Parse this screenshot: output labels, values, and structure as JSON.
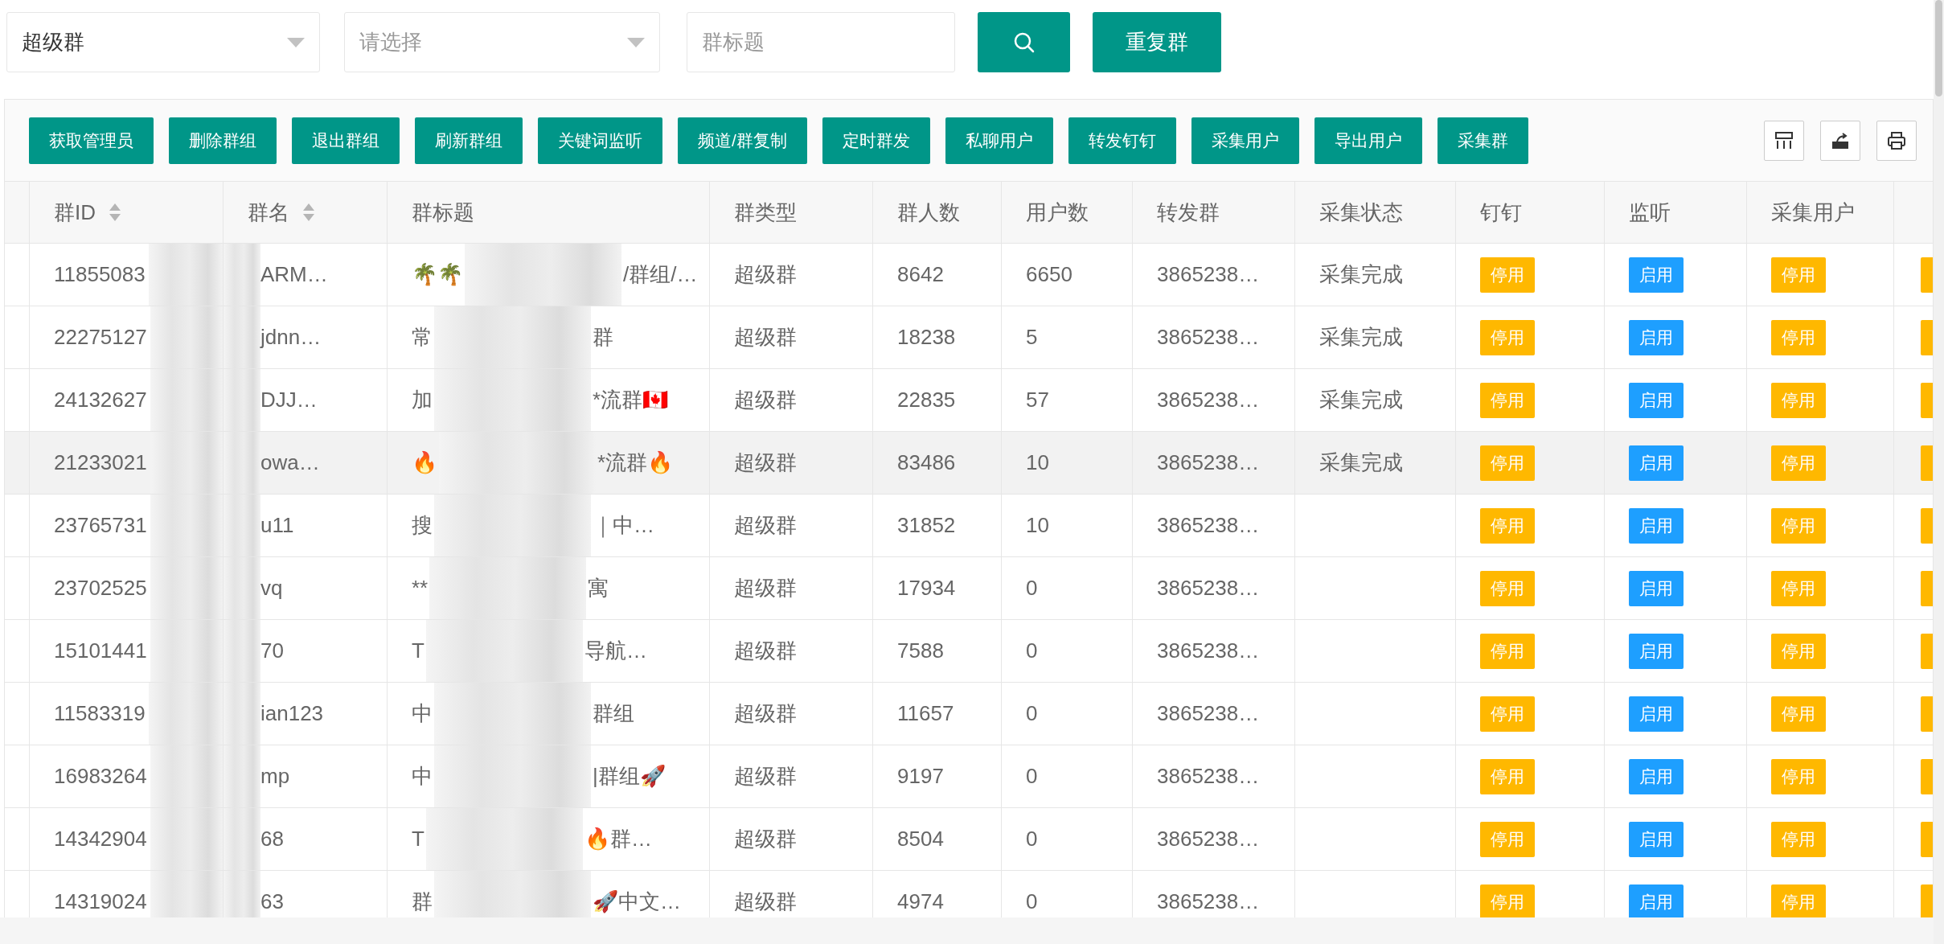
{
  "filters": {
    "group_type_select": {
      "value": "超级群"
    },
    "second_select": {
      "placeholder": "请选择"
    },
    "title_field": {
      "placeholder": "群标题"
    },
    "duplicate_button": "重复群"
  },
  "toolbar": {
    "buttons": [
      "获取管理员",
      "删除群组",
      "退出群组",
      "刷新群组",
      "关键词监听",
      "频道/群复制",
      "定时群发",
      "私聊用户",
      "转发钉钉",
      "采集用户",
      "导出用户",
      "采集群"
    ]
  },
  "table": {
    "columns": [
      {
        "label": "群ID",
        "sortable": true
      },
      {
        "label": "群名",
        "sortable": true
      },
      {
        "label": "群标题",
        "sortable": false
      },
      {
        "label": "群类型",
        "sortable": false
      },
      {
        "label": "群人数",
        "sortable": false
      },
      {
        "label": "用户数",
        "sortable": false
      },
      {
        "label": "转发群",
        "sortable": false
      },
      {
        "label": "采集状态",
        "sortable": false
      },
      {
        "label": "钉钉",
        "sortable": false
      },
      {
        "label": "监听",
        "sortable": false
      },
      {
        "label": "采集用户",
        "sortable": false
      }
    ],
    "rows": [
      {
        "id": "11855083",
        "name": "ARM…",
        "title_prefix": "🌴🌴",
        "title_suffix": "/群组/…",
        "type": "超级群",
        "members": "8642",
        "users": "6650",
        "forward": "3865238…",
        "status": "采集完成",
        "dingtalk": {
          "label": "停用",
          "kind": "warning"
        },
        "monitor": {
          "label": "启用",
          "kind": "normal"
        },
        "collect": {
          "label": "停用",
          "kind": "warning"
        },
        "column_13": {
          "kind": "warning"
        },
        "highlighted": false
      },
      {
        "id": "22275127",
        "name": "jdnn…",
        "title_prefix": "常",
        "title_suffix": "群",
        "type": "超级群",
        "members": "18238",
        "users": "5",
        "forward": "3865238…",
        "status": "采集完成",
        "dingtalk": {
          "label": "停用",
          "kind": "warning"
        },
        "monitor": {
          "label": "启用",
          "kind": "normal"
        },
        "collect": {
          "label": "停用",
          "kind": "warning"
        },
        "column_13": {
          "kind": "warning"
        },
        "highlighted": false
      },
      {
        "id": "24132627",
        "name": "DJJ…",
        "title_prefix": "加",
        "title_suffix": "*流群🇨🇦",
        "type": "超级群",
        "members": "22835",
        "users": "57",
        "forward": "3865238…",
        "status": "采集完成",
        "dingtalk": {
          "label": "停用",
          "kind": "warning"
        },
        "monitor": {
          "label": "启用",
          "kind": "normal"
        },
        "collect": {
          "label": "停用",
          "kind": "warning"
        },
        "column_13": {
          "kind": "warning"
        },
        "highlighted": false
      },
      {
        "id": "21233021",
        "name": "owa…",
        "title_prefix": "🔥",
        "title_suffix": "*流群🔥",
        "type": "超级群",
        "members": "83486",
        "users": "10",
        "forward": "3865238…",
        "status": "采集完成",
        "dingtalk": {
          "label": "停用",
          "kind": "warning"
        },
        "monitor": {
          "label": "启用",
          "kind": "normal"
        },
        "collect": {
          "label": "停用",
          "kind": "warning"
        },
        "column_13": {
          "kind": "warning"
        },
        "highlighted": true
      },
      {
        "id": "23765731",
        "name": "u11",
        "title_prefix": "搜",
        "title_suffix": "｜中…",
        "type": "超级群",
        "members": "31852",
        "users": "10",
        "forward": "3865238…",
        "dingtalk": {
          "label": "停用",
          "kind": "warning"
        },
        "monitor": {
          "label": "启用",
          "kind": "normal"
        },
        "collect": {
          "label": "停用",
          "kind": "warning"
        },
        "column_13": {
          "kind": "warning"
        },
        "highlighted": false
      },
      {
        "id": "23702525",
        "name": "vq",
        "title_prefix": "**",
        "title_suffix": "寓",
        "type": "超级群",
        "members": "17934",
        "users": "0",
        "forward": "3865238…",
        "dingtalk": {
          "label": "停用",
          "kind": "warning"
        },
        "monitor": {
          "label": "启用",
          "kind": "normal"
        },
        "collect": {
          "label": "停用",
          "kind": "warning"
        },
        "column_13": {
          "kind": "warning"
        },
        "highlighted": false
      },
      {
        "id": "15101441",
        "name": "70",
        "title_prefix": "T",
        "title_suffix": "导航…",
        "type": "超级群",
        "members": "7588",
        "users": "0",
        "forward": "3865238…",
        "dingtalk": {
          "label": "停用",
          "kind": "warning"
        },
        "monitor": {
          "label": "启用",
          "kind": "normal"
        },
        "collect": {
          "label": "停用",
          "kind": "warning"
        },
        "column_13": {
          "kind": "warning"
        },
        "highlighted": false
      },
      {
        "id": "11583319",
        "name": "ian123",
        "title_prefix": "中",
        "title_suffix": "群组",
        "type": "超级群",
        "members": "11657",
        "users": "0",
        "forward": "3865238…",
        "dingtalk": {
          "label": "停用",
          "kind": "warning"
        },
        "monitor": {
          "label": "启用",
          "kind": "normal"
        },
        "collect": {
          "label": "停用",
          "kind": "warning"
        },
        "column_13": {
          "kind": "warning"
        },
        "highlighted": false
      },
      {
        "id": "16983264",
        "name": "mp",
        "title_prefix": "中",
        "title_suffix": "|群组🚀",
        "type": "超级群",
        "members": "9197",
        "users": "0",
        "forward": "3865238…",
        "dingtalk": {
          "label": "停用",
          "kind": "warning"
        },
        "monitor": {
          "label": "启用",
          "kind": "normal"
        },
        "collect": {
          "label": "停用",
          "kind": "warning"
        },
        "column_13": {
          "kind": "warning"
        },
        "highlighted": false
      },
      {
        "id": "14342904",
        "name": "68",
        "title_prefix": "T",
        "title_suffix": "🔥群…",
        "type": "超级群",
        "members": "8504",
        "users": "0",
        "forward": "3865238…",
        "dingtalk": {
          "label": "停用",
          "kind": "warning"
        },
        "monitor": {
          "label": "启用",
          "kind": "normal"
        },
        "collect": {
          "label": "停用",
          "kind": "warning"
        },
        "column_13": {
          "kind": "warning"
        },
        "highlighted": false
      },
      {
        "id": "14319024",
        "name": "63",
        "title_prefix": "群",
        "title_suffix": "🚀中文…",
        "type": "超级群",
        "members": "4974",
        "users": "0",
        "forward": "3865238…",
        "dingtalk": {
          "label": "停用",
          "kind": "warning"
        },
        "monitor": {
          "label": "启用",
          "kind": "normal"
        },
        "collect": {
          "label": "停用",
          "kind": "warning"
        },
        "column_13": {
          "kind": "warning"
        },
        "highlighted": false
      }
    ]
  }
}
